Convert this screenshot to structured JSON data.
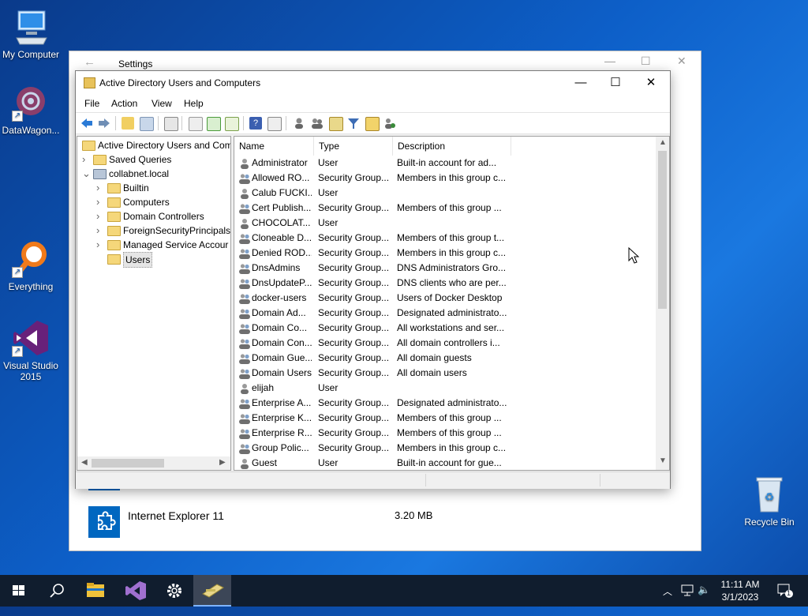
{
  "desktop": {
    "icons": [
      {
        "label": "My Computer"
      },
      {
        "label": "DataWagon..."
      },
      {
        "label": "Everything"
      },
      {
        "label": "Visual Studio 2015"
      },
      {
        "label": "Recycle Bin"
      }
    ]
  },
  "settings_window": {
    "title": "Settings",
    "app_row": {
      "name": "Internet Explorer 11",
      "size": "3.20 MB"
    }
  },
  "aduc": {
    "title": "Active Directory Users and Computers",
    "menu": [
      "File",
      "Action",
      "View",
      "Help"
    ],
    "tree": [
      {
        "label": "Active Directory Users and Com",
        "level": 0,
        "expander": ""
      },
      {
        "label": "Saved Queries",
        "level": 1,
        "expander": ">"
      },
      {
        "label": "collabnet.local",
        "level": 1,
        "expander": "v"
      },
      {
        "label": "Builtin",
        "level": 2,
        "expander": ">"
      },
      {
        "label": "Computers",
        "level": 2,
        "expander": ">"
      },
      {
        "label": "Domain Controllers",
        "level": 2,
        "expander": ">"
      },
      {
        "label": "ForeignSecurityPrincipals",
        "level": 2,
        "expander": ">"
      },
      {
        "label": "Managed Service Accour",
        "level": 2,
        "expander": ">"
      },
      {
        "label": "Users",
        "level": 2,
        "expander": "",
        "selected": true
      }
    ],
    "columns": [
      "Name",
      "Type",
      "Description"
    ],
    "rows": [
      {
        "name": "Administrator",
        "type": "User",
        "desc": "Built-in account for ad...",
        "kind": "user"
      },
      {
        "name": "Allowed RO...",
        "type": "Security Group...",
        "desc": "Members in this group c...",
        "kind": "group"
      },
      {
        "name": "Calub FUCKI...",
        "type": "User",
        "desc": "",
        "kind": "user"
      },
      {
        "name": "Cert Publish...",
        "type": "Security Group...",
        "desc": "Members of this group ...",
        "kind": "group"
      },
      {
        "name": "CHOCOLAT...",
        "type": "User",
        "desc": "",
        "kind": "user"
      },
      {
        "name": "Cloneable D...",
        "type": "Security Group...",
        "desc": "Members of this group t...",
        "kind": "group"
      },
      {
        "name": "Denied ROD...",
        "type": "Security Group...",
        "desc": "Members in this group c...",
        "kind": "group"
      },
      {
        "name": "DnsAdmins",
        "type": "Security Group...",
        "desc": "DNS Administrators Gro...",
        "kind": "group"
      },
      {
        "name": "DnsUpdateP...",
        "type": "Security Group...",
        "desc": "DNS clients who are per...",
        "kind": "group"
      },
      {
        "name": "docker-users",
        "type": "Security Group...",
        "desc": "Users of Docker Desktop",
        "kind": "group"
      },
      {
        "name": "Domain Ad...",
        "type": "Security Group...",
        "desc": "Designated administrato...",
        "kind": "group"
      },
      {
        "name": "Domain Co...",
        "type": "Security Group...",
        "desc": "All workstations and ser...",
        "kind": "group"
      },
      {
        "name": "Domain Con...",
        "type": "Security Group...",
        "desc": "All domain controllers i...",
        "kind": "group"
      },
      {
        "name": "Domain Gue...",
        "type": "Security Group...",
        "desc": "All domain guests",
        "kind": "group"
      },
      {
        "name": "Domain Users",
        "type": "Security Group...",
        "desc": "All domain users",
        "kind": "group"
      },
      {
        "name": "elijah",
        "type": "User",
        "desc": "",
        "kind": "user"
      },
      {
        "name": "Enterprise A...",
        "type": "Security Group...",
        "desc": "Designated administrato...",
        "kind": "group"
      },
      {
        "name": "Enterprise K...",
        "type": "Security Group...",
        "desc": "Members of this group ...",
        "kind": "group"
      },
      {
        "name": "Enterprise R...",
        "type": "Security Group...",
        "desc": "Members of this group ...",
        "kind": "group"
      },
      {
        "name": "Group Polic...",
        "type": "Security Group...",
        "desc": "Members in this group c...",
        "kind": "group"
      },
      {
        "name": "Guest",
        "type": "User",
        "desc": "Built-in account for gue...",
        "kind": "user"
      }
    ]
  },
  "taskbar": {
    "clock_time": "11:11 AM",
    "clock_date": "3/1/2023",
    "notification_count": "1"
  },
  "colors": {
    "accent": "#0067c0",
    "taskbar": "#101d2e"
  }
}
